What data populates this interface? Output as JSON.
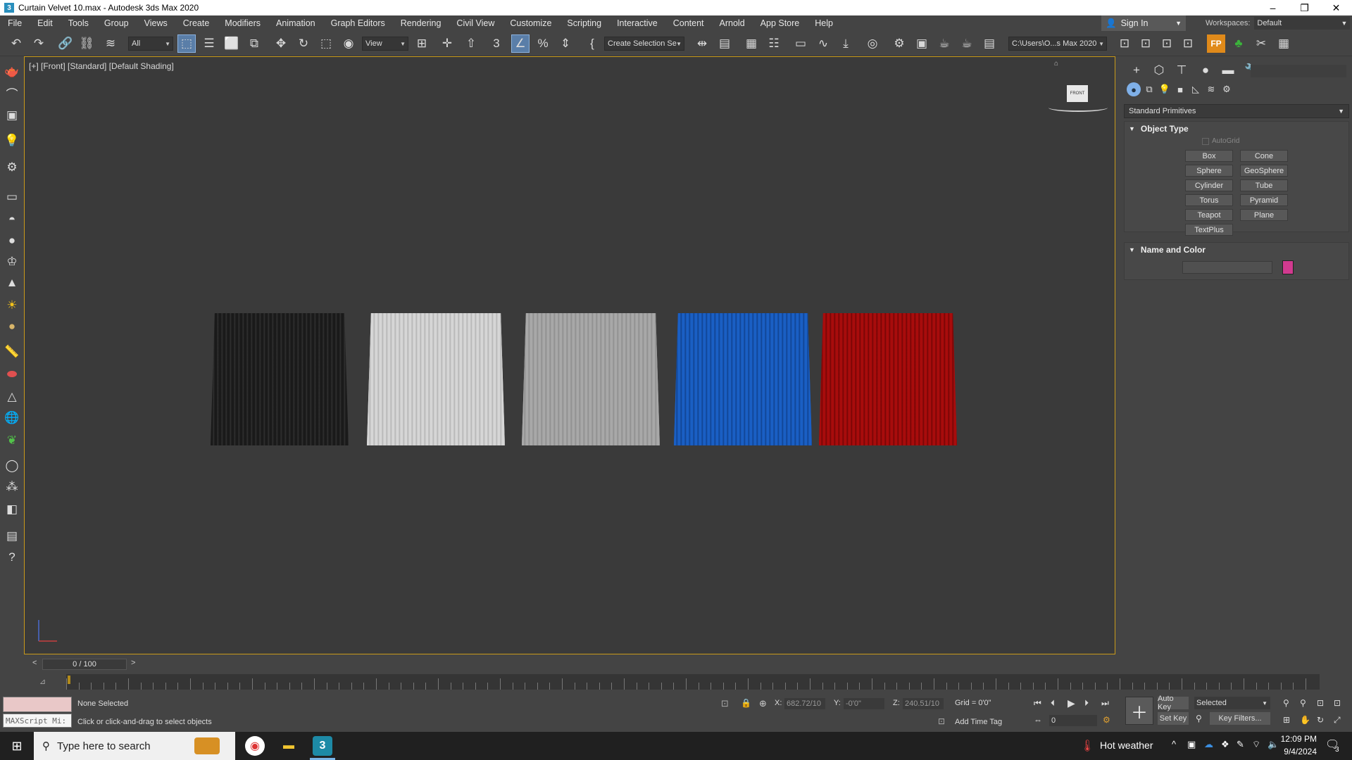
{
  "window": {
    "title": "Curtain Velvet 10.max - Autodesk 3ds Max 2020",
    "app_icon": "3",
    "controls": {
      "minimize": "–",
      "maximize": "❐",
      "close": "✕"
    }
  },
  "menu": [
    "File",
    "Edit",
    "Tools",
    "Group",
    "Views",
    "Create",
    "Modifiers",
    "Animation",
    "Graph Editors",
    "Rendering",
    "Civil View",
    "Customize",
    "Scripting",
    "Interactive",
    "Content",
    "Arnold",
    "App Store",
    "Help"
  ],
  "account": {
    "sign_in": "Sign In",
    "workspaces_label": "Workspaces:",
    "workspace_value": "Default"
  },
  "toolbar": {
    "filter_value": "All",
    "ref_coord_value": "View",
    "named_selection_value": "Create Selection Se",
    "project_path": "C:\\Users\\O...s Max 2020"
  },
  "viewport": {
    "label": "[+] [Front] [Standard] [Default Shading]",
    "viewcube_label": "FRONT",
    "curtains": [
      {
        "name": "black-curtain",
        "color": "#1c1c1c",
        "stripe": "#3a3a3a"
      },
      {
        "name": "white-curtain",
        "color": "#d6d6d6",
        "stripe": "#b0b0b0"
      },
      {
        "name": "gray-curtain",
        "color": "#a8a8a8",
        "stripe": "#8a8a8a"
      },
      {
        "name": "blue-curtain",
        "color": "#1a5fc4",
        "stripe": "#0f3f8a"
      },
      {
        "name": "red-curtain",
        "color": "#a80c0c",
        "stripe": "#6e0505"
      }
    ]
  },
  "command_panel": {
    "dropdown": "Standard Primitives",
    "object_type_title": "Object Type",
    "autogrid": "AutoGrid",
    "primitives": [
      "Box",
      "Cone",
      "Sphere",
      "GeoSphere",
      "Cylinder",
      "Tube",
      "Torus",
      "Pyramid",
      "Teapot",
      "Plane",
      "TextPlus"
    ],
    "name_color_title": "Name and Color",
    "object_color": "#d13a8f"
  },
  "timeline": {
    "frame": "0 / 100",
    "prev": "<",
    "next": ">"
  },
  "status": {
    "selection": "None Selected",
    "prompt": "Click or click-and-drag to select objects",
    "maxscript": "MAXScript Mi:",
    "x_label": "X:",
    "x_value": "682.72/10",
    "y_label": "Y:",
    "y_value": "-0'0\"",
    "z_label": "Z:",
    "z_value": "240.51/10",
    "grid": "Grid = 0'0\"",
    "add_time_tag": "Add Time Tag",
    "auto_key": "Auto Key",
    "set_key": "Set Key",
    "selected": "Selected",
    "key_filters": "Key Filters...",
    "frame_value": "0"
  },
  "taskbar": {
    "search_placeholder": "Type here to search",
    "weather": "Hot weather",
    "time": "12:09 PM",
    "date": "9/4/2024",
    "notifications": "3"
  }
}
